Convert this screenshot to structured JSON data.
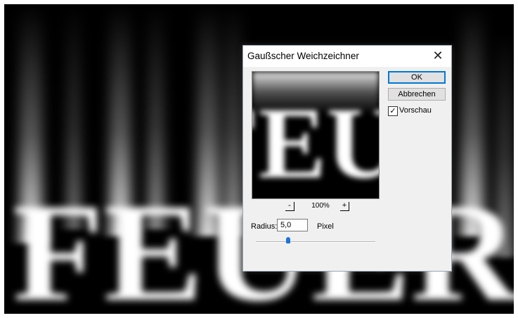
{
  "background": {
    "text": "FEUER"
  },
  "dialog": {
    "title": "Gaußscher Weichzeichner",
    "ok_label": "OK",
    "cancel_label": "Abbrechen",
    "preview_checkbox_label": "Vorschau",
    "preview_checked": true,
    "preview_text": "FEUER",
    "zoom_out_label": "-",
    "zoom_in_label": "+",
    "zoom_value": "100%",
    "radius_label": "Radius:",
    "radius_value": "5,0",
    "unit_label": "Pixel",
    "slider_fraction": 0.27
  },
  "colors": {
    "accent": "#0078d7",
    "slider_thumb": "#1e73d2",
    "canvas": "#000000"
  },
  "icons": {
    "close": "close-icon",
    "check": "checkmark-icon"
  }
}
